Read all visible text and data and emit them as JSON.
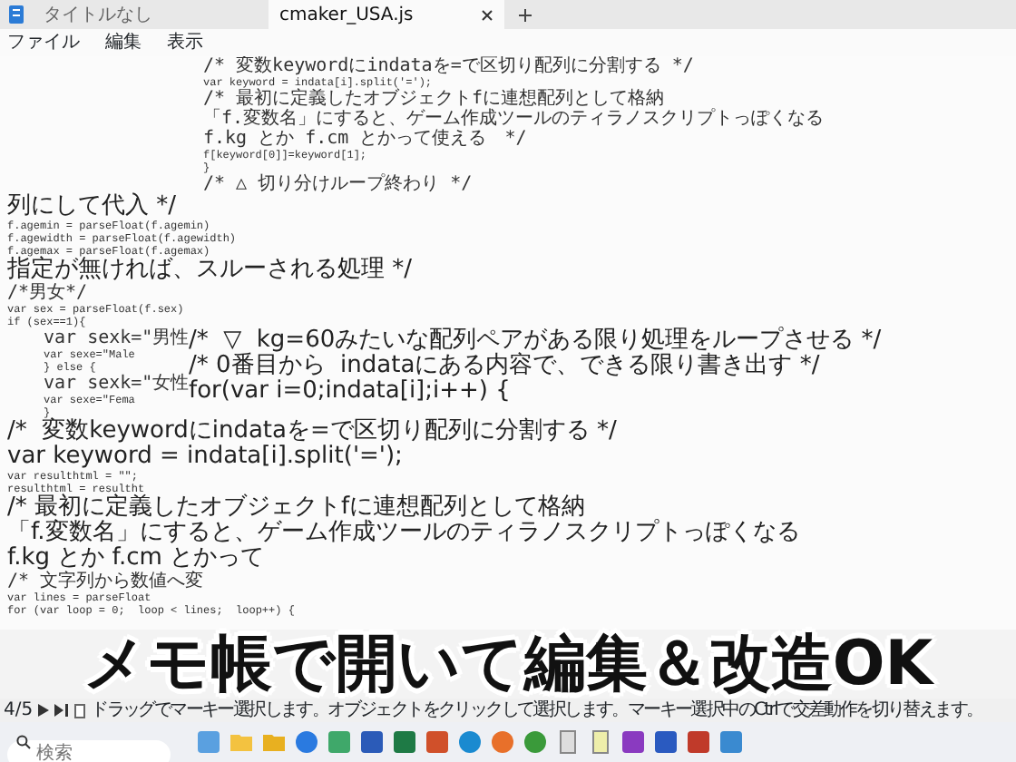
{
  "tabs": [
    {
      "label": "タイトルなし",
      "selected": false
    },
    {
      "label": "cmaker_USA.js",
      "selected": true
    }
  ],
  "menu": [
    "ファイル",
    "編集",
    "表示"
  ],
  "editor": {
    "top_block": [
      {
        "kind": "code_jp",
        "text": "/* 変数keywordにindataを=で区切り配列に分割する */"
      },
      {
        "kind": "code",
        "text": "var keyword = indata[i].split('=');"
      },
      {
        "kind": "code_jp",
        "text": "/* 最初に定義したオブジェクトfに連想配列として格納"
      },
      {
        "kind": "code_jp",
        "text": "「f.変数名」にすると、ゲーム作成ツールのティラノスクリプトっぽくなる"
      },
      {
        "kind": "code_jp",
        "text": "f.kg とか f.cm とかって使える　*/"
      },
      {
        "kind": "code",
        "text": "f[keyword[0]]=keyword[1];"
      },
      {
        "kind": "code",
        "text": "}"
      },
      {
        "kind": "code_jp",
        "text": "/* △ 切り分けループ終わり */"
      }
    ],
    "body": [
      {
        "kind": "overlay",
        "text": "列にして代入 */"
      },
      {
        "kind": "code",
        "text": "f.agemin = parseFloat(f.agemin)"
      },
      {
        "kind": "code",
        "text": "f.agewidth = parseFloat(f.agewidth)"
      },
      {
        "kind": "code",
        "text": "f.agemax = parseFloat(f.agemax)"
      },
      {
        "kind": "overlay",
        "text": "指定が無ければ、スルーされる処理 */"
      },
      {
        "kind": "code_jp",
        "text": "/*男女*/"
      },
      {
        "kind": "code",
        "text": "var sex = parseFloat(f.sex)"
      },
      {
        "kind": "code",
        "text": "if (sex==1){"
      },
      {
        "kind": "split",
        "left": [
          {
            "kind": "code_jp",
            "text": "var sexk=\"男性"
          },
          {
            "kind": "code",
            "text": "var sexe=\"Male"
          },
          {
            "kind": "code",
            "text": "} else {"
          },
          {
            "kind": "code_jp",
            "text": "var sexk=\"女性"
          },
          {
            "kind": "code",
            "text": "var sexe=\"Fema"
          },
          {
            "kind": "code",
            "text": "}"
          }
        ],
        "right": [
          {
            "kind": "overlay",
            "text": "/*  ▽  kg=60みたいな配列ペアがある限り処理をループさせる */"
          },
          {
            "kind": "overlay",
            "text": "/* 0番目から  indataにある内容で、できる限り書き出す */"
          },
          {
            "kind": "overlay",
            "text": "for(var i=0;indata[i];i++) {"
          }
        ]
      },
      {
        "kind": "overlay",
        "text": "/*  変数keywordにindataを=で区切り配列に分割する */"
      },
      {
        "kind": "overlay",
        "text": "var keyword = indata[i].split('=');"
      },
      {
        "kind": "code",
        "text": "var resulthtml = \"\";"
      },
      {
        "kind": "code",
        "text": "resulthtml = resultht"
      },
      {
        "kind": "overlay",
        "text": "/* 最初に定義したオブジェクトfに連想配列として格納"
      },
      {
        "kind": "overlay",
        "text": "「f.変数名」にすると、ゲーム作成ツールのティラノスクリプトっぽくなる"
      },
      {
        "kind": "overlay",
        "text": "f.kg とか f.cm とかって"
      },
      {
        "kind": "code_jp",
        "text": "/* 文字列から数値へ変"
      },
      {
        "kind": "code",
        "text": "var lines = parseFloat"
      },
      {
        "kind": "code",
        "text": "for (var loop = 0;  loop < lines;  loop++) {"
      }
    ]
  },
  "caption": "メモ帳で開いて編集＆改造OK",
  "status_bar": {
    "page": "4/5",
    "message": "ドラッグでマーキー選択します。オブジェクトをクリックして選択します。マーキー選択中のCtrlで交差動作を切り替えます。"
  },
  "taskbar": {
    "search": {
      "placeholder": "検索"
    }
  }
}
